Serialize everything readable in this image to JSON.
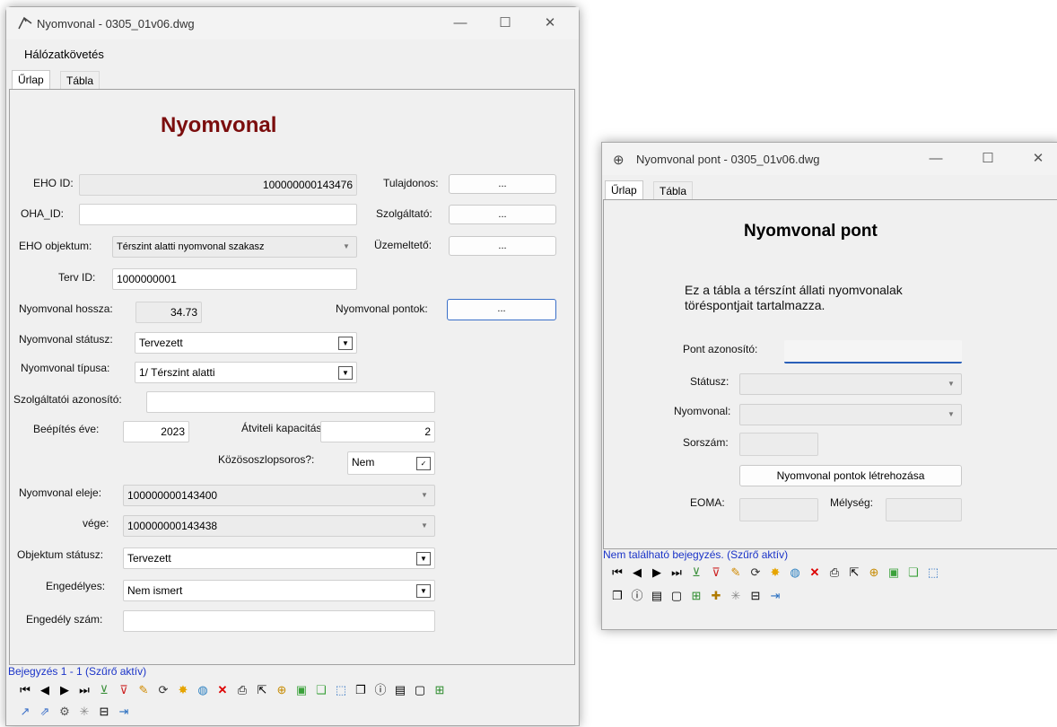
{
  "win1": {
    "title": "Nyomvonal - 0305_01v06.dwg",
    "menu": "Hálózatkövetés",
    "tabs": [
      "Űrlap",
      "Tábla"
    ],
    "heading": "Nyomvonal",
    "labels": {
      "eho_id": "EHO ID:",
      "oha_id": "OHA_ID:",
      "eho_obj": "EHO objektum:",
      "terv_id": "Terv ID:",
      "hossz": "Nyomvonal hossza:",
      "statusz": "Nyomvonal státusz:",
      "tipus": "Nyomvonal típusa:",
      "szolg_az": "Szolgáltatói azonosító:",
      "beepites": "Beépítés éve:",
      "atviteli": "Átviteli kapacitás:",
      "kozos": "Közösoszlopsoros?:",
      "eleje": "Nyomvonal eleje:",
      "vege": "vége:",
      "obj_statusz": "Objektum státusz:",
      "engedelyes": "Engedélyes:",
      "engedely_szam": "Engedély szám:",
      "tulajdonos": "Tulajdonos:",
      "szolgaltato": "Szolgáltató:",
      "uzemelteto": "Üzemeltető:",
      "pontok": "Nyomvonal pontok:"
    },
    "values": {
      "eho_id": "100000000143476",
      "oha_id": "",
      "eho_obj": "Térszint alatti nyomvonal szakasz",
      "terv_id": "1000000001",
      "hossz": "34.73",
      "statusz": "Tervezett",
      "tipus": "1/ Térszint alatti",
      "szolg_az": "",
      "beepites": "2023",
      "atviteli": "2",
      "kozos": "Nem",
      "eleje": "100000000143400",
      "vege": "100000000143438",
      "obj_statusz": "Tervezett",
      "engedelyes": "Nem ismert",
      "engedely_szam": ""
    },
    "ellipsis": "...",
    "nav_text": "Bejegyzés 1 - 1 (Szűrő aktív)"
  },
  "win2": {
    "title": "Nyomvonal pont - 0305_01v06.dwg",
    "tabs": [
      "Űrlap",
      "Tábla"
    ],
    "heading": "Nyomvonal pont",
    "description": "Ez a tábla a térszínt állati nyomvonalak töréspontjait tartalmazza.",
    "labels": {
      "pont_az": "Pont azonosító:",
      "statusz": "Státusz:",
      "nyomvonal": "Nyomvonal:",
      "sorszam": "Sorszám:",
      "eoma": "EOMA:",
      "melyseg": "Mélység:"
    },
    "create_button": "Nyomvonal pontok létrehozása",
    "nav_text": "Nem található bejegyzés. (Szűrő aktív)"
  },
  "colors": {
    "heading": "#7b0d0d",
    "nav_text": "#1a33c8",
    "accent": "#3a6fc8"
  }
}
